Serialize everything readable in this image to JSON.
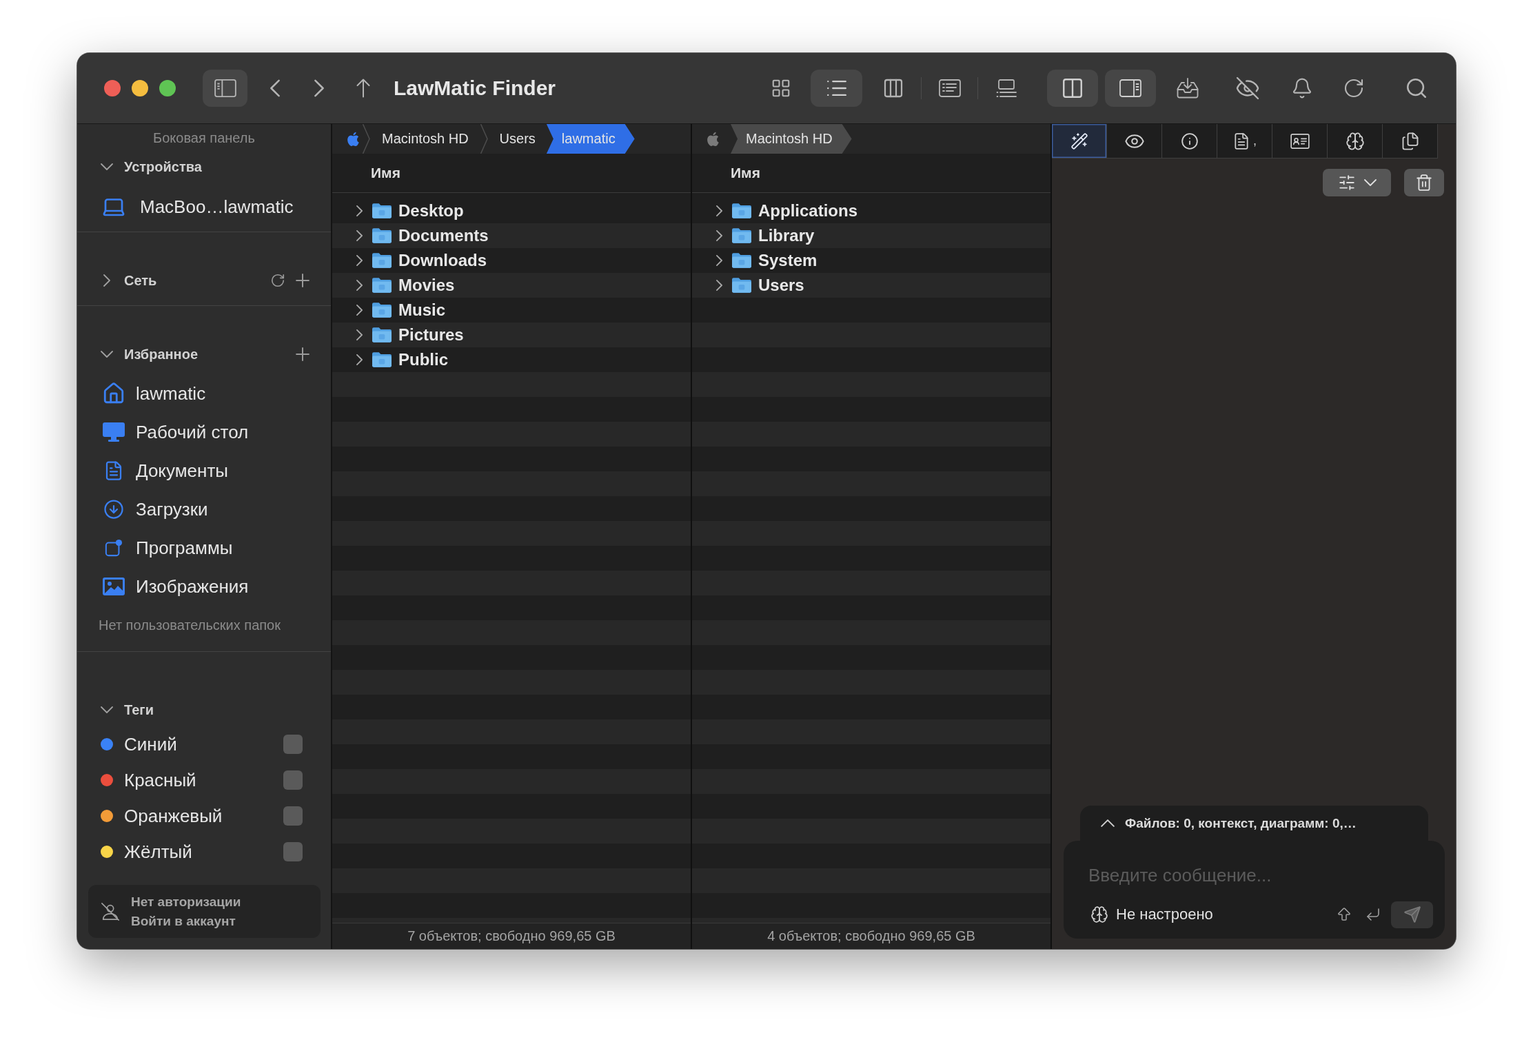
{
  "window": {
    "title": "LawMatic Finder"
  },
  "toolbar": {
    "sidebar_toggle": {
      "selected": true
    },
    "view_buttons": [
      {
        "kind": "grid",
        "selected": false
      },
      {
        "kind": "list",
        "selected": true
      },
      {
        "kind": "columns",
        "selected": false
      },
      {
        "kind": "detail",
        "selected": false
      },
      {
        "kind": "gallery",
        "selected": false
      }
    ],
    "panel_buttons": [
      {
        "kind": "split",
        "selected": true
      },
      {
        "kind": "inspector",
        "selected": true
      }
    ]
  },
  "sidebar": {
    "title": "Боковая панель",
    "devices": {
      "label": "Устройства",
      "expanded": true,
      "items": [
        {
          "label": "MacBoo…lawmatic"
        }
      ]
    },
    "network": {
      "label": "Сеть",
      "expanded": false
    },
    "favorites": {
      "label": "Избранное",
      "expanded": true,
      "items": [
        {
          "kind": "home",
          "label": "lawmatic"
        },
        {
          "kind": "desktop",
          "label": "Рабочий стол"
        },
        {
          "kind": "documents",
          "label": "Документы"
        },
        {
          "kind": "downloads",
          "label": "Загрузки"
        },
        {
          "kind": "applications",
          "label": "Программы"
        },
        {
          "kind": "pictures",
          "label": "Изображения"
        }
      ],
      "note": "Нет пользовательских папок"
    },
    "tags": {
      "label": "Теги",
      "expanded": true,
      "items": [
        {
          "label": "Синий",
          "color": "#3a82f6",
          "checked": false
        },
        {
          "label": "Красный",
          "color": "#eb4e3d",
          "checked": false
        },
        {
          "label": "Оранжевый",
          "color": "#f29b38",
          "checked": false
        },
        {
          "label": "Жёлтый",
          "color": "#f8d448",
          "checked": false
        }
      ]
    },
    "account": {
      "status": "Нет авторизации",
      "action": "Войти в аккаунт"
    }
  },
  "panes": [
    {
      "active": true,
      "breadcrumb": [
        {
          "label": "Macintosh HD",
          "selected": false
        },
        {
          "label": "Users",
          "selected": false
        },
        {
          "label": "lawmatic",
          "selected": true
        }
      ],
      "column": "Имя",
      "rows": [
        {
          "name": "Desktop",
          "expanded": false
        },
        {
          "name": "Documents",
          "expanded": false
        },
        {
          "name": "Downloads",
          "expanded": false
        },
        {
          "name": "Movies",
          "expanded": false
        },
        {
          "name": "Music",
          "expanded": false
        },
        {
          "name": "Pictures",
          "expanded": false
        },
        {
          "name": "Public",
          "expanded": false
        }
      ],
      "status": "7 объектов; свободно 969,65 GB"
    },
    {
      "active": false,
      "breadcrumb": [
        {
          "label": "Macintosh HD",
          "selected": true
        }
      ],
      "column": "Имя",
      "rows": [
        {
          "name": "Applications",
          "expanded": false
        },
        {
          "name": "Library",
          "expanded": false
        },
        {
          "name": "System",
          "expanded": false
        },
        {
          "name": "Users",
          "expanded": false
        }
      ],
      "status": "4 объектов; свободно 969,65 GB"
    }
  ],
  "inspector": {
    "tabs": [
      {
        "kind": "assistant",
        "selected": true
      },
      {
        "kind": "preview",
        "selected": false
      },
      {
        "kind": "info",
        "selected": false
      },
      {
        "kind": "document",
        "selected": false,
        "suffix": ","
      },
      {
        "kind": "contact",
        "selected": false
      },
      {
        "kind": "brain",
        "selected": false
      },
      {
        "kind": "files",
        "selected": false
      }
    ],
    "context": {
      "summary": "Файлов: 0, контекст, диаграмм: 0,…",
      "expanded": false
    },
    "message": {
      "placeholder": "Введите сообщение..."
    },
    "model_status": "Не настроено",
    "send": {
      "disabled": true
    }
  }
}
